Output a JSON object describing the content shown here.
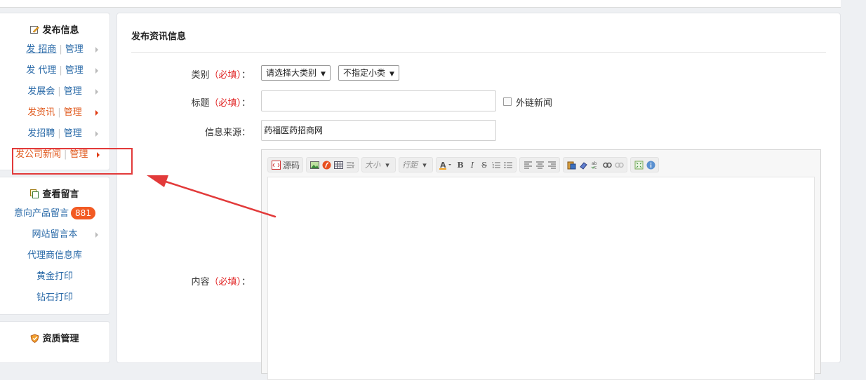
{
  "sidebar": {
    "publish": {
      "title": "发布信息",
      "rows": [
        {
          "name": "发 招商",
          "manage": "管理"
        },
        {
          "name": "发 代理",
          "manage": "管理"
        },
        {
          "name": "发展会",
          "manage": "管理"
        },
        {
          "name": "发资讯",
          "manage": "管理"
        },
        {
          "name": "发招聘",
          "manage": "管理"
        },
        {
          "name": "发公司新闻",
          "manage": "管理"
        }
      ]
    },
    "messages": {
      "title": "查看留言",
      "items": [
        "意向产品留言",
        "网站留言本",
        "代理商信息库",
        "黄金打印",
        "钻石打印"
      ],
      "badge": "881"
    },
    "qualification": {
      "title": "资质管理"
    }
  },
  "form": {
    "title": "发布资讯信息",
    "category_label": "类别",
    "required_text": "（必填）",
    "colon": "：",
    "category_select": "请选择大类别",
    "subcategory_select": "不指定小类",
    "title_label": "标题",
    "external_label": "外链新闻",
    "source_label": "信息来源：",
    "source_value": "药福医药招商网",
    "content_label": "内容"
  },
  "editor": {
    "source_btn": "源码",
    "font_size": "大小",
    "line_height": "行距",
    "bold": "B",
    "italic": "I",
    "strike": "S"
  },
  "colors": {
    "active": "#e05a1e",
    "link": "#2a6aa8",
    "badge": "#f25a23",
    "annotation": "#e23a3a"
  }
}
